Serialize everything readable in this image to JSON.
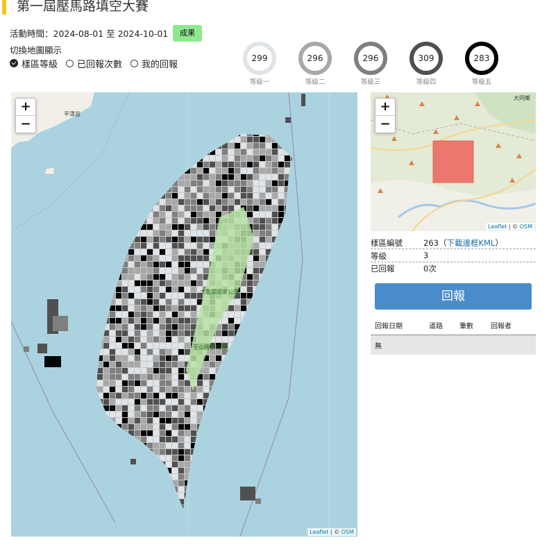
{
  "header": {
    "title": "第一屆壓馬路填空大賽"
  },
  "event": {
    "period": "活動時間：2024-08-01 至 2024-10-01",
    "result_button": "成果"
  },
  "display_toggle": {
    "label": "切換地圖顯示",
    "options": [
      "樣區等級",
      "已回報次數",
      "我的回報"
    ],
    "selected": "樣區等級"
  },
  "levels": [
    {
      "count": "299",
      "label": "等級一",
      "color": "#dfe4e8"
    },
    {
      "count": "296",
      "label": "等級二",
      "color": "#a8a8a8"
    },
    {
      "count": "296",
      "label": "等級三",
      "color": "#7f7f7f"
    },
    {
      "count": "309",
      "label": "等級四",
      "color": "#505050"
    },
    {
      "count": "283",
      "label": "等級五",
      "color": "#050505"
    }
  ],
  "map": {
    "zoom_in": "+",
    "zoom_out": "−",
    "attribution_leaflet": "Leaflet",
    "attribution_sep": " | © ",
    "attribution_osm": "OSM",
    "labels": {
      "penghu": "平潭县",
      "park1": "太魯閣國家公園",
      "park2": "玉山國家公園"
    }
  },
  "minimap": {
    "zoom_in": "+",
    "zoom_out": "−",
    "place_label": "大同鄉"
  },
  "detail": {
    "id_label": "樣區編號",
    "id_value": "263",
    "kml_open": "（",
    "kml_link": "下載邊框KML",
    "kml_close": "）",
    "level_label": "等級",
    "level_value": "3",
    "reported_label": "已回報",
    "reported_value": "0次"
  },
  "report_button": "回報",
  "report_table": {
    "headers": [
      "回報日期",
      "道路",
      "筆數",
      "回報者"
    ],
    "empty_text": "無"
  }
}
